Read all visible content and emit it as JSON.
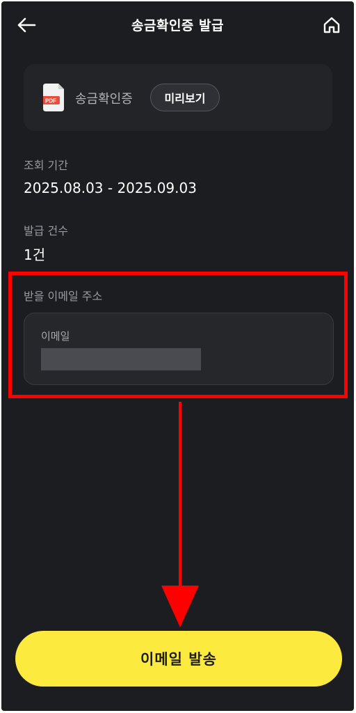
{
  "header": {
    "title": "송금확인증 발급",
    "back_icon": "arrow-left-icon",
    "home_icon": "home-icon"
  },
  "document": {
    "icon_label": "PDF",
    "label": "송금확인증",
    "preview_label": "미리보기"
  },
  "period": {
    "label": "조회 기간",
    "value": "2025.08.03 - 2025.09.03"
  },
  "count": {
    "label": "발급 건수",
    "value": "1건"
  },
  "email": {
    "section_label": "받을 이메일 주소",
    "field_label": "이메일"
  },
  "actions": {
    "send_label": "이메일 발송"
  },
  "colors": {
    "background": "#1c1d20",
    "card": "#232428",
    "accent_yellow": "#fdea3e",
    "highlight_red": "#ff0000",
    "pdf_red": "#e94b3c"
  }
}
